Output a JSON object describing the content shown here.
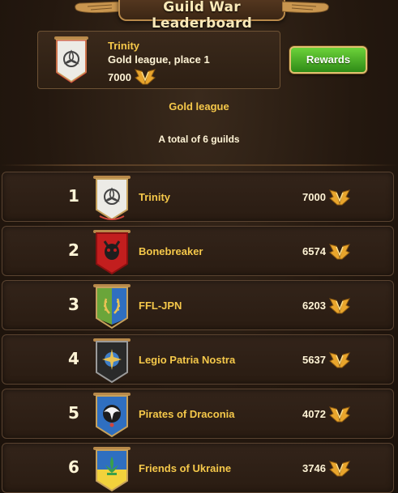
{
  "title": "Guild War Leaderboard",
  "my_guild": {
    "name": "Trinity",
    "league_place": "Gold league, place 1",
    "score": "7000",
    "emblem": "triquetra-emblem"
  },
  "rewards_label": "Rewards",
  "league_label": "Gold league",
  "total_label": "A total of 6 guilds",
  "score_icon": "wings-trophy-icon",
  "colors": {
    "gold_text": "#f5c84a",
    "rewards_green": "#4ab02a",
    "panel_bg": "#2d1f13"
  },
  "guilds": [
    {
      "place": "1",
      "name": "Trinity",
      "score": "7000",
      "emblem": "triquetra-emblem",
      "banner_color": "#e8e4dc"
    },
    {
      "place": "2",
      "name": "Bonebreaker",
      "score": "6574",
      "emblem": "skull-emblem",
      "banner_color": "#c21e1e"
    },
    {
      "place": "3",
      "name": "FFL-JPN",
      "score": "6203",
      "emblem": "laurel-emblem",
      "banner_color": "#6aa53a"
    },
    {
      "place": "4",
      "name": "Legio Patria Nostra",
      "score": "5637",
      "emblem": "star-emblem",
      "banner_color": "#2a2a2a"
    },
    {
      "place": "5",
      "name": "Pirates of Draconia",
      "score": "4072",
      "emblem": "eagle-emblem",
      "banner_color": "#2f6fc0"
    },
    {
      "place": "6",
      "name": "Friends of Ukraine",
      "score": "3746",
      "emblem": "fleur-emblem",
      "banner_color": "#2f6fc0"
    }
  ]
}
